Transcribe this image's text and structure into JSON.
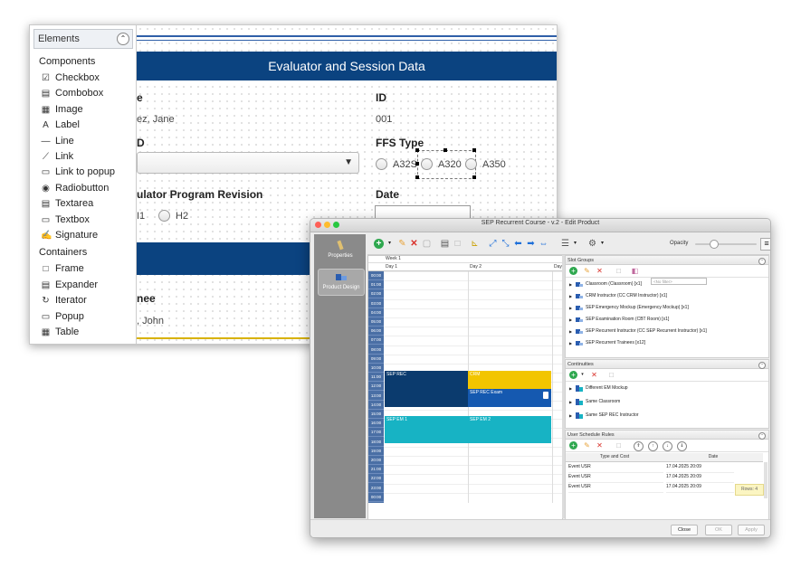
{
  "back_window": {
    "elements_panel": {
      "title": "Elements",
      "sections": [
        {
          "title": "Components",
          "items": [
            {
              "label": "Checkbox",
              "icon": "checkbox-icon"
            },
            {
              "label": "Combobox",
              "icon": "combobox-icon"
            },
            {
              "label": "Image",
              "icon": "image-icon"
            },
            {
              "label": "Label",
              "icon": "label-icon"
            },
            {
              "label": "Line",
              "icon": "line-icon"
            },
            {
              "label": "Link",
              "icon": "link-icon"
            },
            {
              "label": "Link to popup",
              "icon": "link-popup-icon"
            },
            {
              "label": "Radiobutton",
              "icon": "radiobutton-icon"
            },
            {
              "label": "Textarea",
              "icon": "textarea-icon"
            },
            {
              "label": "Textbox",
              "icon": "textbox-icon"
            },
            {
              "label": "Signature",
              "icon": "signature-icon"
            }
          ]
        },
        {
          "title": "Containers",
          "items": [
            {
              "label": "Frame",
              "icon": "frame-icon"
            },
            {
              "label": "Expander",
              "icon": "expander-icon"
            },
            {
              "label": "Iterator",
              "icon": "iterator-icon"
            },
            {
              "label": "Popup",
              "icon": "popup-icon"
            },
            {
              "label": "Table",
              "icon": "table-icon"
            }
          ]
        }
      ]
    },
    "form": {
      "banner_title": "Evaluator and Session Data",
      "name_label_partial": "e",
      "name_value_partial": "ez, Jane",
      "id_label": "ID",
      "id_value": "001",
      "d_label_partial": "D",
      "ffs_type_label": "FFS Type",
      "ffs_options": [
        "A32S",
        "A320",
        "A350"
      ],
      "revision_label_partial": "ulator Program Revision",
      "revision_options": [
        "H1",
        "H2"
      ],
      "revision_option_partial": "I1",
      "date_label": "Date",
      "trainee_label_partial": "nee",
      "trainee_value_partial": ", John"
    }
  },
  "front_window": {
    "title": "SEP Recurrent Course - v.2 - Edit Product",
    "rail": [
      {
        "label": "Properties",
        "selected": false
      },
      {
        "label": "Product Design",
        "selected": true
      }
    ],
    "toolbar": {
      "opacity_label": "Opacity"
    },
    "schedule": {
      "week_label": "Week 1",
      "days": [
        "Day 1",
        "Day 2",
        "Day"
      ],
      "hours": [
        "00:00",
        "01:00",
        "02:00",
        "03:00",
        "04:00",
        "05:00",
        "06:00",
        "07:00",
        "08:00",
        "09:00",
        "10:00",
        "11:00",
        "12:00",
        "13:00",
        "14:00",
        "15:00",
        "16:00",
        "17:00",
        "18:00",
        "19:00",
        "20:00",
        "21:00",
        "22:00",
        "23:00",
        "00:00"
      ],
      "events": [
        {
          "label": "SEP REC",
          "color": "#0b3b6e"
        },
        {
          "label": "CRM",
          "color": "#f2c500"
        },
        {
          "label": "SEP REC Exam",
          "color": "#1559b0"
        },
        {
          "label": "SEP EM 1",
          "color": "#17b3c4"
        },
        {
          "label": "SEP EM 2",
          "color": "#17b3c4"
        }
      ]
    },
    "slot_groups": {
      "title": "Slot Groups",
      "filter_placeholder": "<No filter>",
      "items": [
        "Classroom (Classroom) [x1]",
        "CRM Instructor (CC CRM Instructor) [x1]",
        "SEP Emergency Mockup (Emergency Mockup) [x1]",
        "SEP Examination Room (CBT Room) [x1]",
        "SEP Recurrent Instructor (CC SEP Recurrent Instructor) [x1]",
        "SEP Recurrent Trainees [x12]"
      ]
    },
    "continuities": {
      "title": "Continuities",
      "items": [
        "Different EM Mockup",
        "Same Classroom",
        "Same SEP REC Instructor"
      ]
    },
    "user_rules": {
      "title": "User Schedule Rules",
      "columns": [
        "Type and Cost",
        "Date"
      ],
      "rows": [
        [
          "Event USR",
          "17.04.2025 20:09"
        ],
        [
          "Event USR",
          "17.04.2025 20:09"
        ],
        [
          "Event USR",
          "17.04.2025 20:09"
        ]
      ],
      "rows_badge": "Rows: 4"
    },
    "footer": {
      "close": "Close",
      "ok": "OK",
      "apply": "Apply"
    }
  }
}
